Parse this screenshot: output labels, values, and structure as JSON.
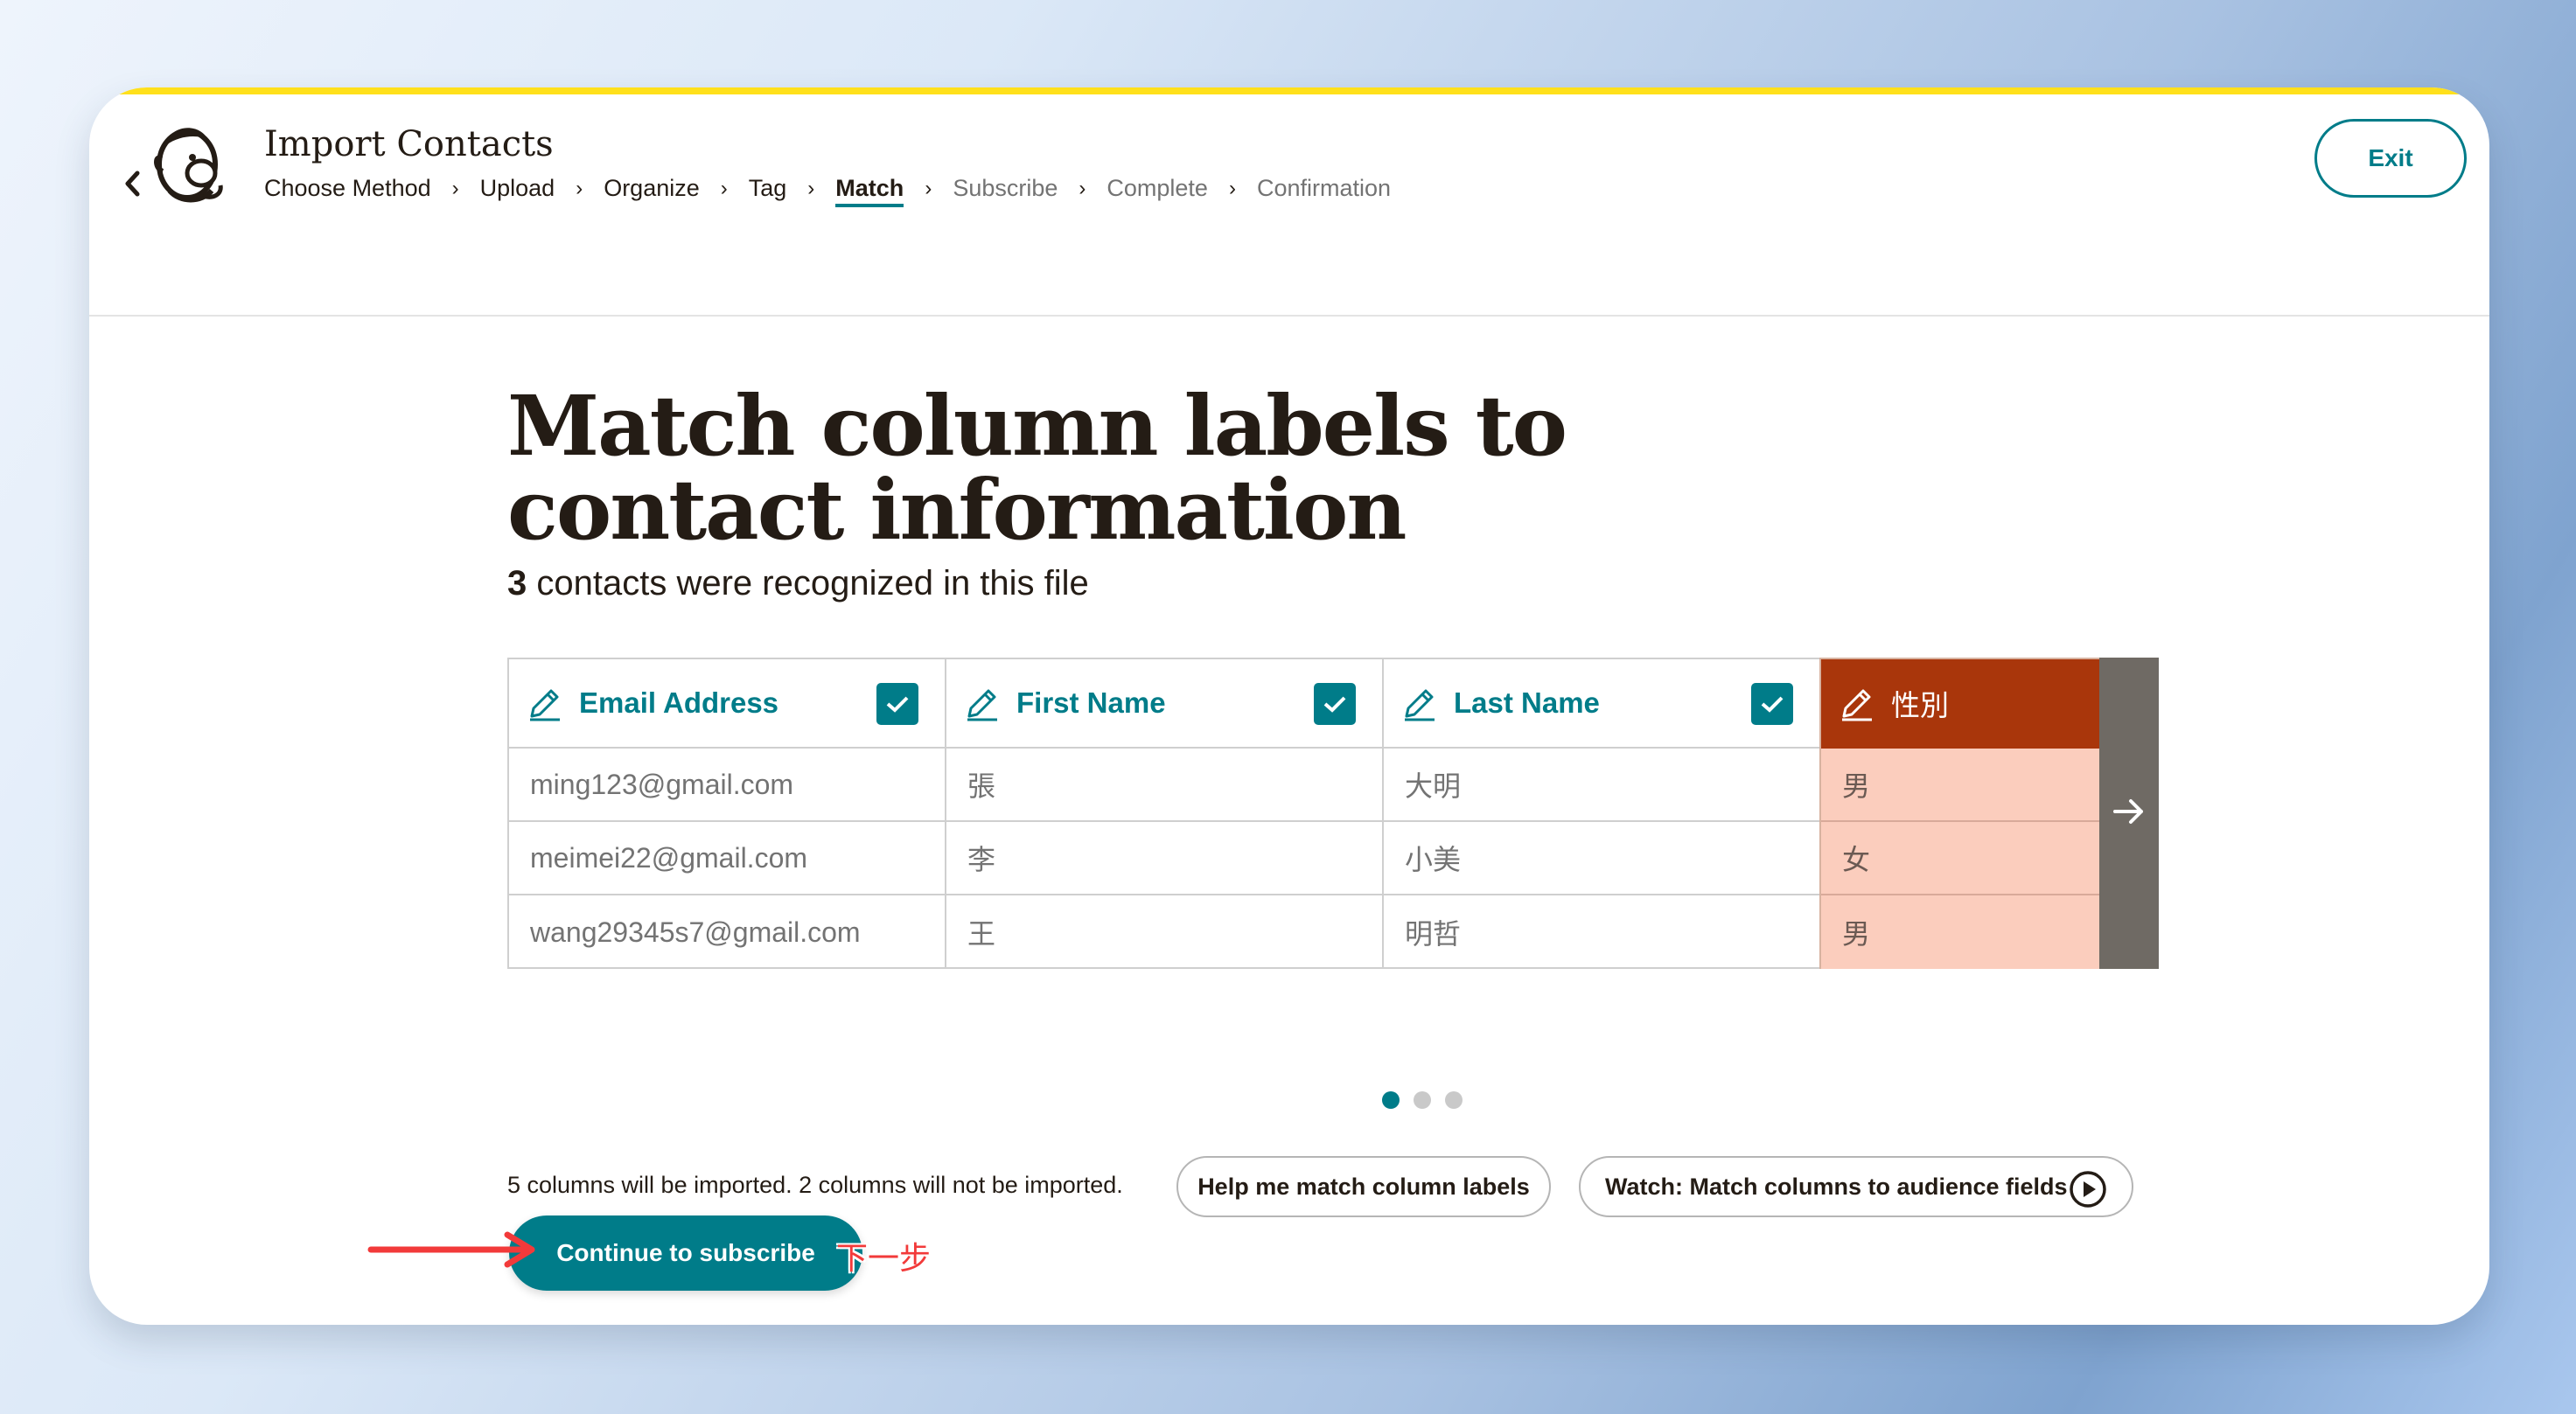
{
  "header": {
    "title": "Import Contacts",
    "exit_label": "Exit",
    "breadcrumbs": [
      {
        "label": "Choose Method"
      },
      {
        "label": "Upload"
      },
      {
        "label": "Organize"
      },
      {
        "label": "Tag"
      },
      {
        "label": "Match"
      },
      {
        "label": "Subscribe"
      },
      {
        "label": "Complete"
      },
      {
        "label": "Confirmation"
      }
    ],
    "separator": "›"
  },
  "main": {
    "heading": "Match column labels to contact information",
    "recognized_count": "3",
    "recognized_text": "contacts were recognized in this file",
    "columns": [
      {
        "label": "Email Address",
        "values": [
          "ming123@gmail.com",
          "meimei22@gmail.com",
          "wang29345s7@gmail.com"
        ]
      },
      {
        "label": "First Name",
        "values": [
          "張",
          "李",
          "王"
        ]
      },
      {
        "label": "Last Name",
        "values": [
          "大明",
          "小美",
          "明哲"
        ]
      },
      {
        "label": "性別",
        "values": [
          "男",
          "女",
          "男"
        ]
      }
    ],
    "pagination": {
      "pages": 3,
      "current": 1
    },
    "import_note": "5 columns will be imported. 2 columns will not be imported.",
    "help_button": "Help me match column labels",
    "watch_button": "Watch: Match columns to audience fields",
    "continue_button": "Continue to subscribe"
  },
  "annotation": {
    "text": "下一步",
    "color": "#f23a3a"
  },
  "colors": {
    "accent": "#007c89",
    "unmatched_header": "#a9360b",
    "unmatched_cell": "#fbcdbd",
    "brand_yellow": "#ffe01b"
  },
  "icons": {
    "back": "chevron-left-icon",
    "logo": "mailchimp-freddie-icon",
    "edit": "pencil-icon",
    "check": "checkbox-checked-icon",
    "next": "arrow-right-icon",
    "play": "play-circle-icon"
  }
}
